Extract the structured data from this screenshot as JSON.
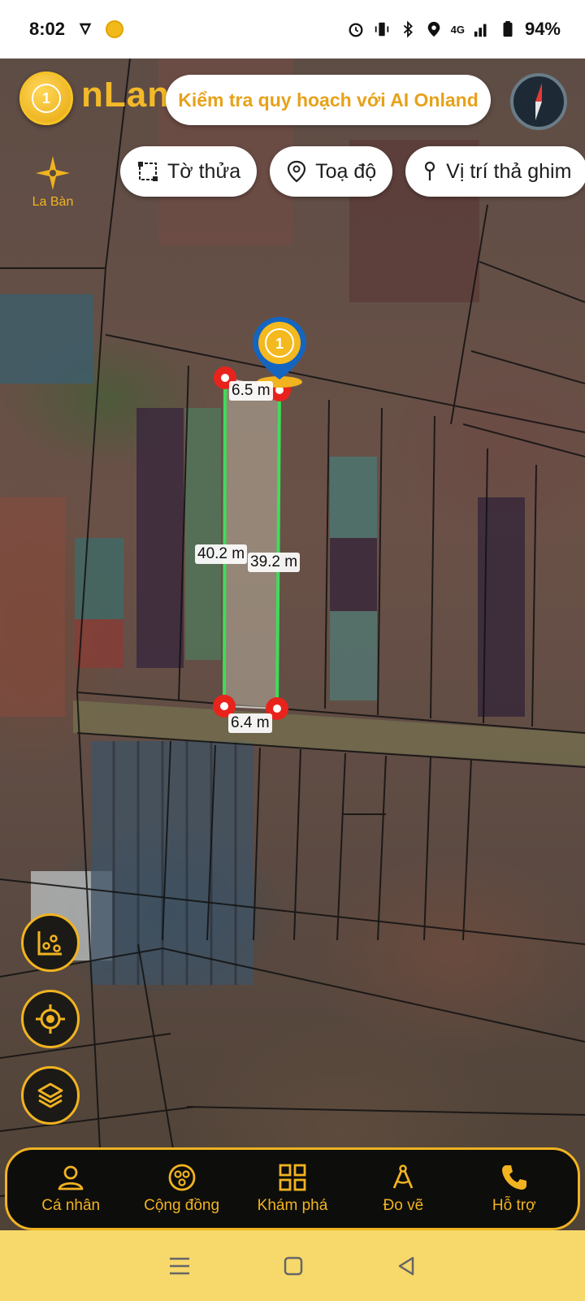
{
  "status_bar": {
    "time": "8:02",
    "network": "4G",
    "battery": "94%"
  },
  "app": {
    "brand_text": "nLan",
    "banner": "Kiểm tra quy hoạch với AI Onland",
    "compass_label": "La Bàn"
  },
  "chips": [
    {
      "icon": "parcel-icon",
      "label": "Tờ thửa"
    },
    {
      "icon": "location-pin-icon",
      "label": "Toạ độ"
    },
    {
      "icon": "drop-pin-icon",
      "label": "Vị trí thả ghim"
    }
  ],
  "measurements": {
    "top": "6.5 m",
    "left": "40.2 m",
    "right": "39.2 m",
    "bottom": "6.4 m"
  },
  "side_buttons": [
    {
      "icon": "chart-scatter-icon"
    },
    {
      "icon": "crosshair-icon"
    },
    {
      "icon": "layers-icon"
    }
  ],
  "bottom_nav": [
    {
      "icon": "user-icon",
      "label": "Cá nhân"
    },
    {
      "icon": "community-icon",
      "label": "Cộng đồng"
    },
    {
      "icon": "grid-icon",
      "label": "Khám phá"
    },
    {
      "icon": "measure-icon",
      "label": "Đo vẽ"
    },
    {
      "icon": "phone-icon",
      "label": "Hỗ trợ"
    }
  ],
  "colors": {
    "accent": "#f1b320",
    "plot_line": "#3fdc5a",
    "marker": "#e8231c"
  }
}
